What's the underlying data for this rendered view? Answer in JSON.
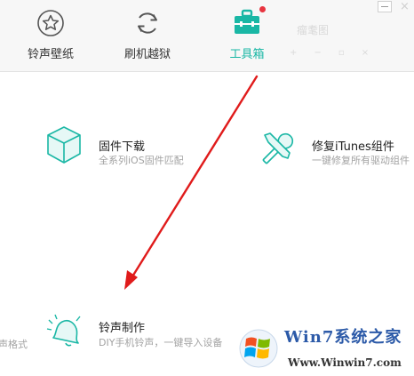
{
  "tabs": [
    {
      "label": "铃声壁纸",
      "icon": "star-icon"
    },
    {
      "label": "刷机越狱",
      "icon": "refresh-icon"
    },
    {
      "label": "工具箱",
      "icon": "toolbox-icon",
      "active": true
    }
  ],
  "topbar": {
    "faded_title": "瘤耄图",
    "window_controls": [
      "minimize",
      "close"
    ]
  },
  "tools": [
    {
      "title": "固件下载",
      "subtitle": "全系列iOS固件匹配",
      "icon": "cube-icon"
    },
    {
      "title": "修复iTunes组件",
      "subtitle": "一键修复所有驱动组件",
      "icon": "wrench-icon"
    },
    {
      "title": "铃声制作",
      "subtitle": "DIY手机铃声，一键导入设备",
      "icon": "bell-icon"
    }
  ],
  "partial_left_text": "声格式",
  "watermark": {
    "name": "Win7系统之家",
    "url": "Www.Winwin7.com"
  },
  "colors": {
    "accent": "#1ab7a5",
    "badge": "#e8343f",
    "arrow": "#e01b1b"
  }
}
